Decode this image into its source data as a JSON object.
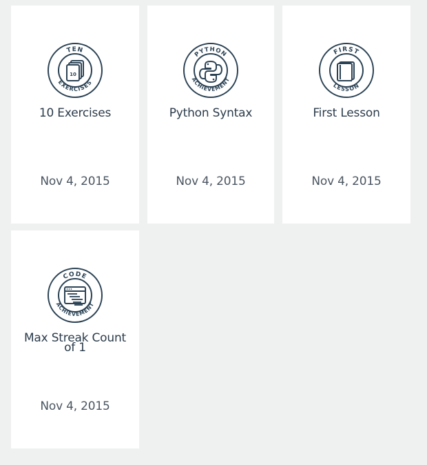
{
  "colors": {
    "page_background": "#eff0f0",
    "card_background": "#ffffff",
    "badge_stroke": "#2b4254",
    "title_text": "#2b3b4a",
    "date_text": "#4a5560"
  },
  "cards": [
    {
      "badge_icon": "ten-exercises-badge-icon",
      "badge_top_text": "TEN",
      "badge_bottom_text": "EXERCISES",
      "badge_inner_text": "10",
      "title": "10 Exercises",
      "date": "Nov 4, 2015"
    },
    {
      "badge_icon": "python-achievement-badge-icon",
      "badge_top_text": "PYTHON",
      "badge_bottom_text": "ACHIEVEMENT",
      "title": "Python Syntax",
      "date": "Nov 4, 2015"
    },
    {
      "badge_icon": "first-lesson-badge-icon",
      "badge_top_text": "FIRST",
      "badge_bottom_text": "LESSON",
      "title": "First Lesson",
      "date": "Nov 4, 2015"
    },
    {
      "badge_icon": "code-achievement-badge-icon",
      "badge_top_text": "CODE",
      "badge_bottom_text": "ACHIEVEMENT",
      "title": "Max Streak Count of 1",
      "date": "Nov 4, 2015"
    }
  ]
}
